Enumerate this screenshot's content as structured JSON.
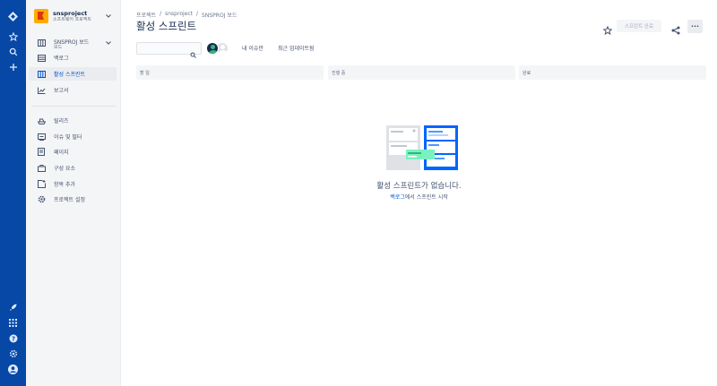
{
  "sidebar": {
    "project_name": "snsproject",
    "project_type": "소프트웨어 프로젝트",
    "board_name": "SNSPROJ 보드",
    "board_sub": "보드",
    "items": [
      {
        "label": "백로그",
        "icon": "backlog-icon"
      },
      {
        "label": "활성 스프린트",
        "icon": "board-icon",
        "active": true
      },
      {
        "label": "보고서",
        "icon": "chart-icon"
      },
      {
        "label": "릴리즈",
        "icon": "ship-icon"
      },
      {
        "label": "이슈 및 필터",
        "icon": "issues-icon"
      },
      {
        "label": "페이지",
        "icon": "page-icon"
      },
      {
        "label": "구성 요소",
        "icon": "component-icon"
      },
      {
        "label": "항목 추가",
        "icon": "add-item-icon"
      },
      {
        "label": "프로젝트 설정",
        "icon": "gear-icon"
      }
    ]
  },
  "breadcrumb": [
    "프로젝트",
    "/",
    "snsproject",
    "/",
    "SNSPROJ 보드"
  ],
  "page_title": "활성 스프린트",
  "toolbar": {
    "complete_sprint": "스프린트 완료",
    "more": "···"
  },
  "filters": {
    "search_placeholder": "",
    "only_my_issues": "내 이슈만",
    "recently_updated": "최근 업데이트됨"
  },
  "columns": [
    "할 일",
    "진행 중",
    "완료"
  ],
  "empty_state": {
    "title": "활성 스프린트가 없습니다.",
    "link": "백로그",
    "rest": "에서 스프린트 시작"
  },
  "colors": {
    "global_nav": "#0747A6",
    "accent": "#0052CC",
    "sidebar_bg": "#F4F5F7"
  }
}
